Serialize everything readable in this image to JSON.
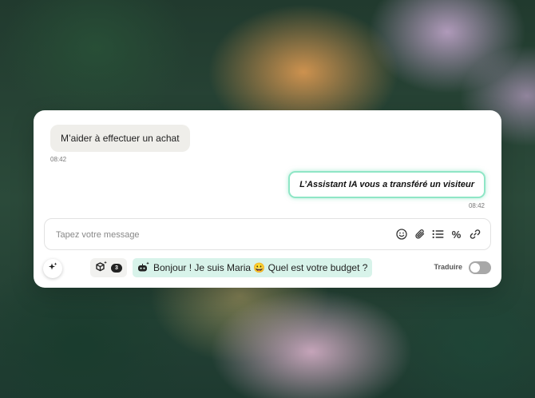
{
  "conversation": {
    "incoming_message": {
      "text": "M’aider à effectuer un achat",
      "time": "08:42"
    },
    "outgoing_message": {
      "text": "L’Assistant IA vous a transféré un visiteur",
      "time": "08:42",
      "accent_color": "#8fe6c6"
    }
  },
  "composer": {
    "placeholder": "Tapez votre message",
    "value": "",
    "tools": [
      "emoji-icon",
      "paperclip-icon",
      "list-icon",
      "percent-icon",
      "link-icon"
    ],
    "percent_glyph": "%"
  },
  "footer": {
    "ai_button_icon": "sparkle-icon",
    "macro_icon": "cube-sparkle-icon",
    "macro_count": "3",
    "suggestion": {
      "icon": "robot-sparkle-icon",
      "text": "Bonjour ! Je suis Maria 😀 Quel est votre budget ?",
      "background": "#d8f3ea"
    },
    "translate_label": "Traduire",
    "translate_enabled": false
  }
}
